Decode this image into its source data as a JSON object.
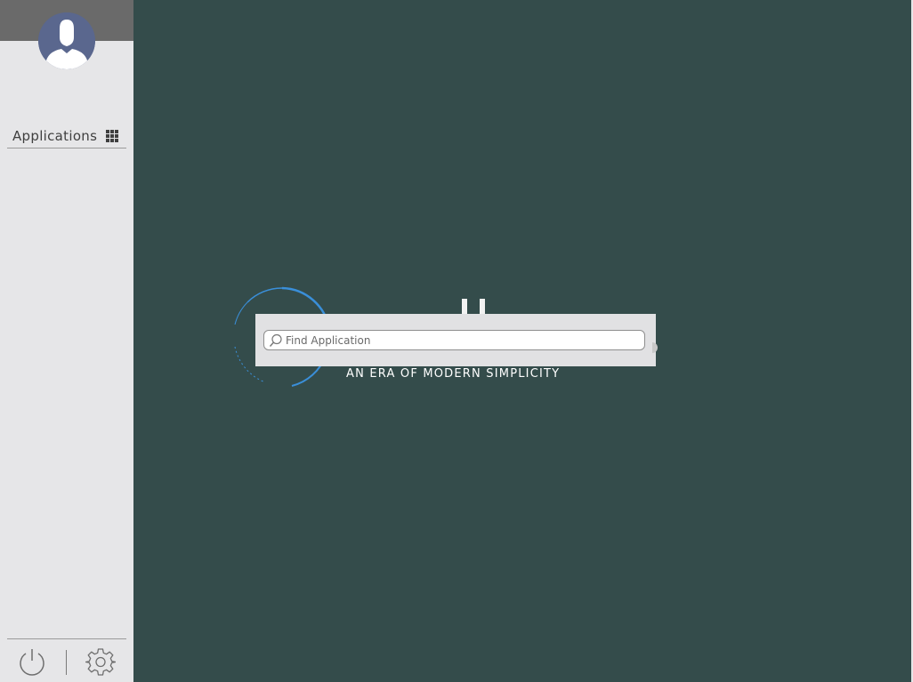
{
  "sidebar": {
    "applications_label": "Applications",
    "avatar_icon": "user-avatar-icon",
    "grid_icon": "app-grid-icon",
    "power_icon": "power-icon",
    "settings_icon": "gear-icon"
  },
  "desktop": {
    "tagline": "AN ERA OF MODERN SIMPLICITY"
  },
  "search": {
    "placeholder": "Find Application",
    "value": ""
  },
  "colors": {
    "desktop_bg": "#344c4b",
    "sidebar_bg": "#e6e6e8",
    "sidebar_top": "#6a6a6a",
    "avatar_bg": "#5a678e",
    "logo_blue": "#3a8fd9"
  }
}
